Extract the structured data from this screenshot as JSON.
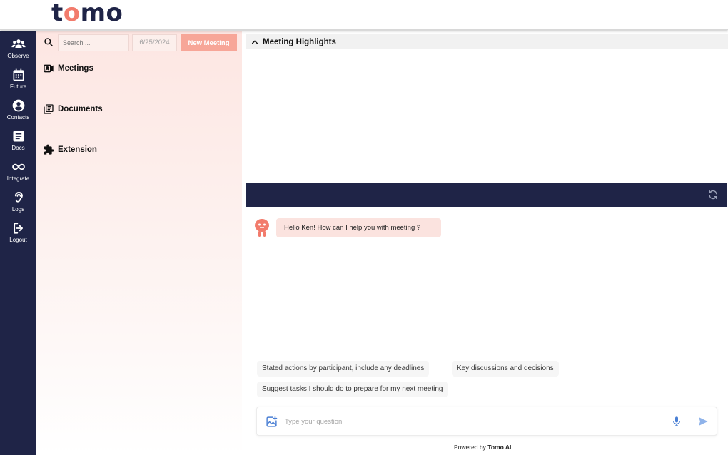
{
  "brand": {
    "logo_text_a": "t",
    "logo_text_b": "o",
    "logo_text_c": "mo"
  },
  "nav": {
    "items": [
      {
        "label": "Observe",
        "icon": "users-icon"
      },
      {
        "label": "Future",
        "icon": "calendar-icon"
      },
      {
        "label": "Contacts",
        "icon": "contact-icon"
      },
      {
        "label": "Docs",
        "icon": "document-icon"
      },
      {
        "label": "Integrate",
        "icon": "infinity-icon"
      },
      {
        "label": "Logs",
        "icon": "ear-icon"
      },
      {
        "label": "Logout",
        "icon": "logout-icon"
      }
    ]
  },
  "sidebar": {
    "search_placeholder": "Search ...",
    "date_value": "6/25/2024",
    "new_meeting_label": "New Meeting",
    "links": [
      {
        "label": "Meetings",
        "icon": "video-contact-icon"
      },
      {
        "label": "Documents",
        "icon": "library-books-icon"
      },
      {
        "label": "Extension",
        "icon": "puzzle-icon"
      }
    ]
  },
  "main": {
    "highlights_title": "Meeting Highlights",
    "bot_greeting": "Hello Ken! How can I help you with meeting ?",
    "suggestions": [
      "Stated actions by participant, include any deadlines",
      "Key discussions and decisions",
      "Suggest tasks I should do to prepare for my next meeting"
    ],
    "input_placeholder": "Type your question",
    "powered_prefix": "Powered by",
    "powered_brand": "Tomo AI"
  },
  "colors": {
    "navy": "#1f2447",
    "accent": "#f7a698",
    "brand_dot": "#f27b6c",
    "bubble": "#fbe3df",
    "icon_blue": "#4a7fd4"
  }
}
